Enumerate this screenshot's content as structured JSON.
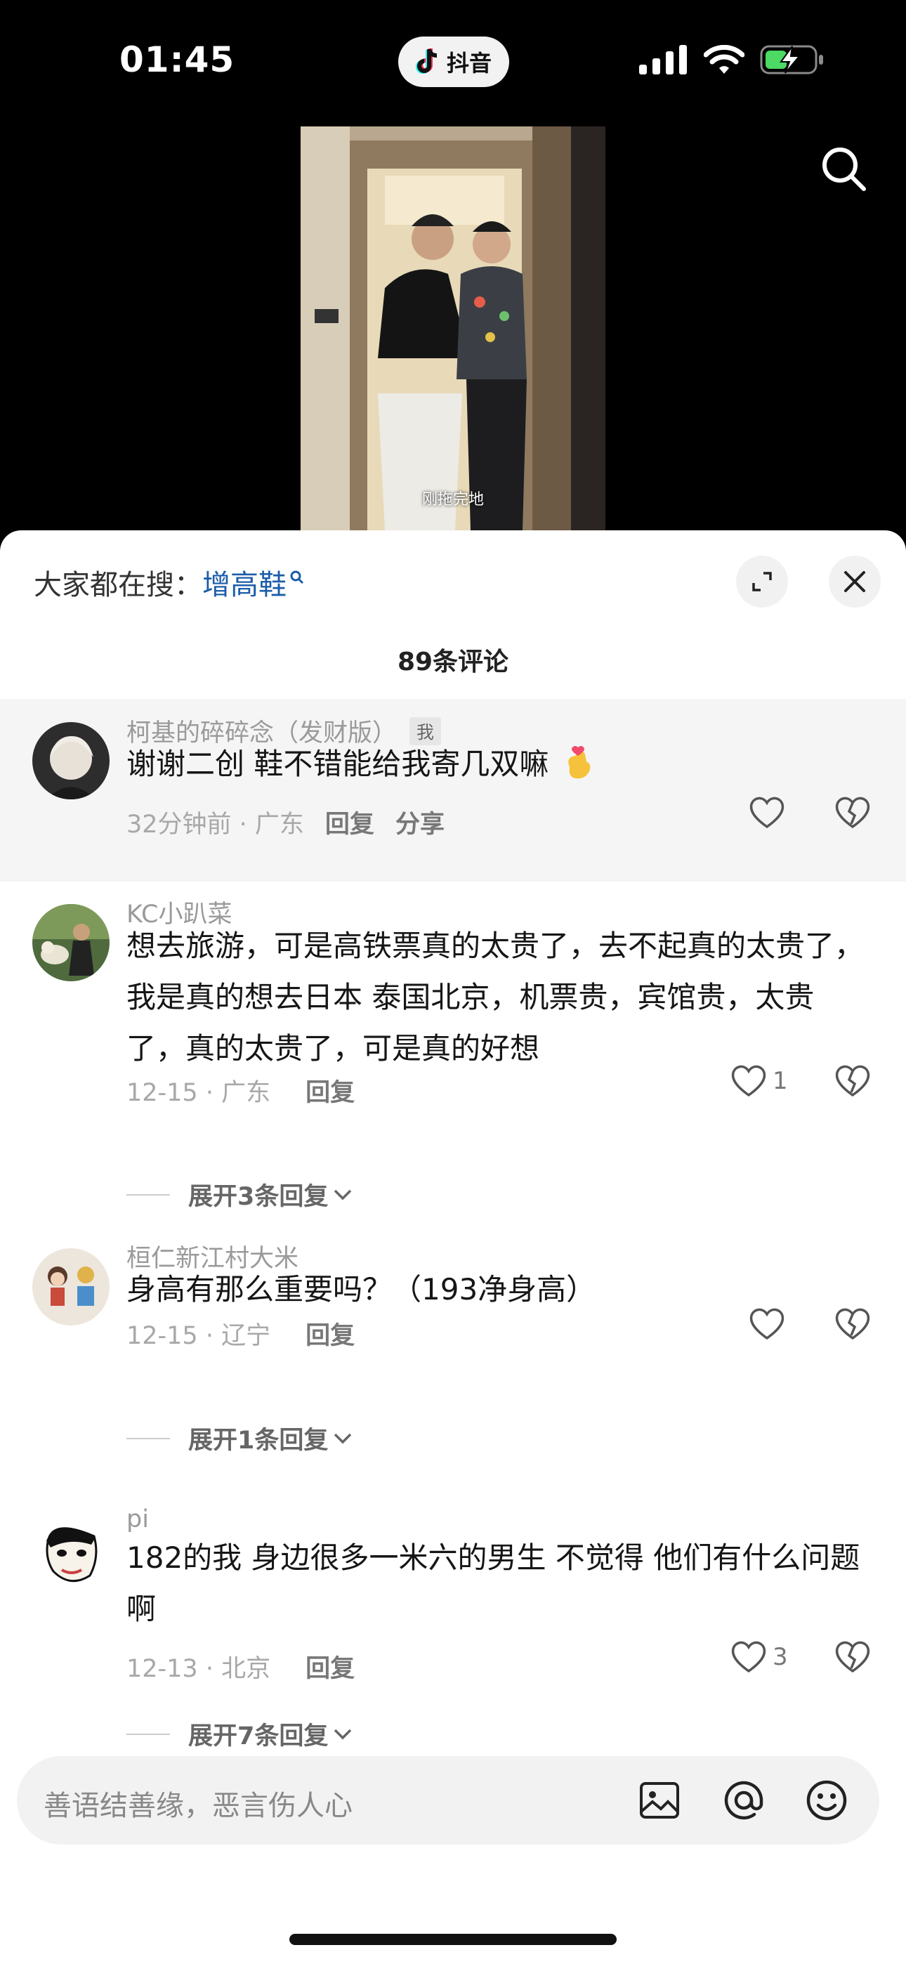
{
  "status_bar": {
    "time": "01:45",
    "app_name": "抖音"
  },
  "video": {
    "caption": "刚拖完地"
  },
  "comments_panel": {
    "search_prefix": "大家都在搜：",
    "search_keyword": "增高鞋",
    "count_label": "89条评论"
  },
  "comments": [
    {
      "username": "柯基的碎碎念（发财版）",
      "me_tag": "我",
      "text": "谢谢二创 鞋不错能给我寄几双嘛",
      "meta": "32分钟前 · 广东",
      "reply_label": "回复",
      "share_label": "分享",
      "likes": ""
    },
    {
      "username": "KC小趴菜",
      "text": "想去旅游，可是高铁票真的太贵了，去不起真的太贵了，我是真的想去日本  泰国北京，机票贵，宾馆贵，太贵了，真的太贵了，可是真的好想",
      "meta": "12-15 · 广东",
      "reply_label": "回复",
      "likes": "1",
      "expand_label": "展开3条回复"
    },
    {
      "username": "桓仁新江村大米",
      "text": "身高有那么重要吗？（193净身高）",
      "meta": "12-15 · 辽宁",
      "reply_label": "回复",
      "likes": "",
      "expand_label": "展开1条回复"
    },
    {
      "username": "pi",
      "text": "182的我 身边很多一米六的男生 不觉得 他们有什么问题啊",
      "meta": "12-13 · 北京",
      "reply_label": "回复",
      "likes": "3",
      "expand_label": "展开7条回复"
    }
  ],
  "input": {
    "placeholder": "善语结善缘，恶言伤人心"
  },
  "icons": {
    "signal": "signal-icon",
    "wifi": "wifi-icon",
    "battery": "battery-charging-icon",
    "search": "search-icon",
    "expand": "expand-icon",
    "close": "close-icon",
    "like": "heart-icon",
    "dislike": "broken-heart-icon",
    "image": "image-icon",
    "mention": "at-icon",
    "emoji": "emoji-icon"
  },
  "colors": {
    "keyword": "#1c5da8",
    "battery_green": "#4cd964"
  }
}
